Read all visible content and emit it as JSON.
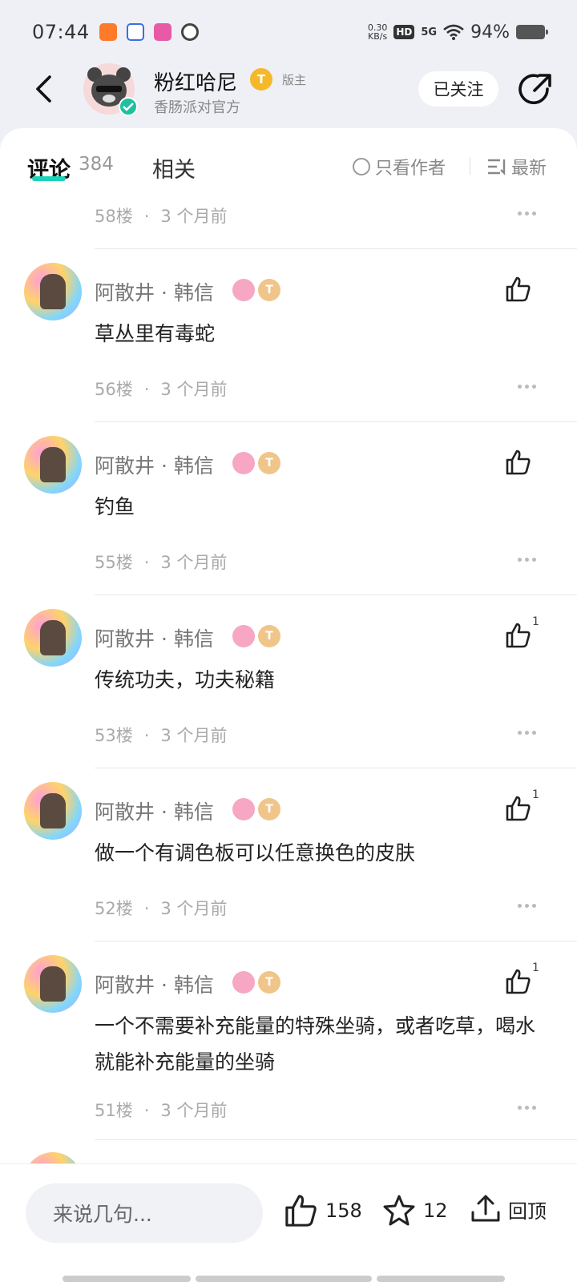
{
  "status_bar": {
    "time": "07:44",
    "speed_value": "0.30",
    "speed_unit": "KB/s",
    "hd": "HD",
    "network": "5G",
    "battery": "94%"
  },
  "header": {
    "author_name": "粉红哈尼",
    "level_badge": "T",
    "role_tag": "版主",
    "author_subtitle": "香肠派对官方",
    "follow_label": "已关注"
  },
  "tabs": {
    "comment_label": "评论",
    "comment_count": "384",
    "related_label": "相关",
    "only_author_label": "只看作者",
    "sort_label": "最新"
  },
  "top_floor": {
    "floor": "58楼",
    "time": "3 个月前"
  },
  "comments": [
    {
      "name": "阿散井 · 韩信",
      "text": "草丛里有毒蛇",
      "floor": "56楼",
      "time": "3 个月前",
      "likes": ""
    },
    {
      "name": "阿散井 · 韩信",
      "text": "钓鱼",
      "floor": "55楼",
      "time": "3 个月前",
      "likes": ""
    },
    {
      "name": "阿散井 · 韩信",
      "text": "传统功夫，功夫秘籍",
      "floor": "53楼",
      "time": "3 个月前",
      "likes": "1"
    },
    {
      "name": "阿散井 · 韩信",
      "text": "做一个有调色板可以任意换色的皮肤",
      "floor": "52楼",
      "time": "3 个月前",
      "likes": "1"
    },
    {
      "name": "阿散井 · 韩信",
      "text": "一个不需要补充能量的特殊坐骑，或者吃草，喝水就能补充能量的坐骑",
      "floor": "51楼",
      "time": "3 个月前",
      "likes": "1"
    }
  ],
  "bottom_bar": {
    "input_placeholder": "来说几句...",
    "like_count": "158",
    "star_count": "12",
    "top_label": "回顶"
  },
  "colors": {
    "accent": "#1bd3b8",
    "badge_gold": "#f5b82a"
  }
}
